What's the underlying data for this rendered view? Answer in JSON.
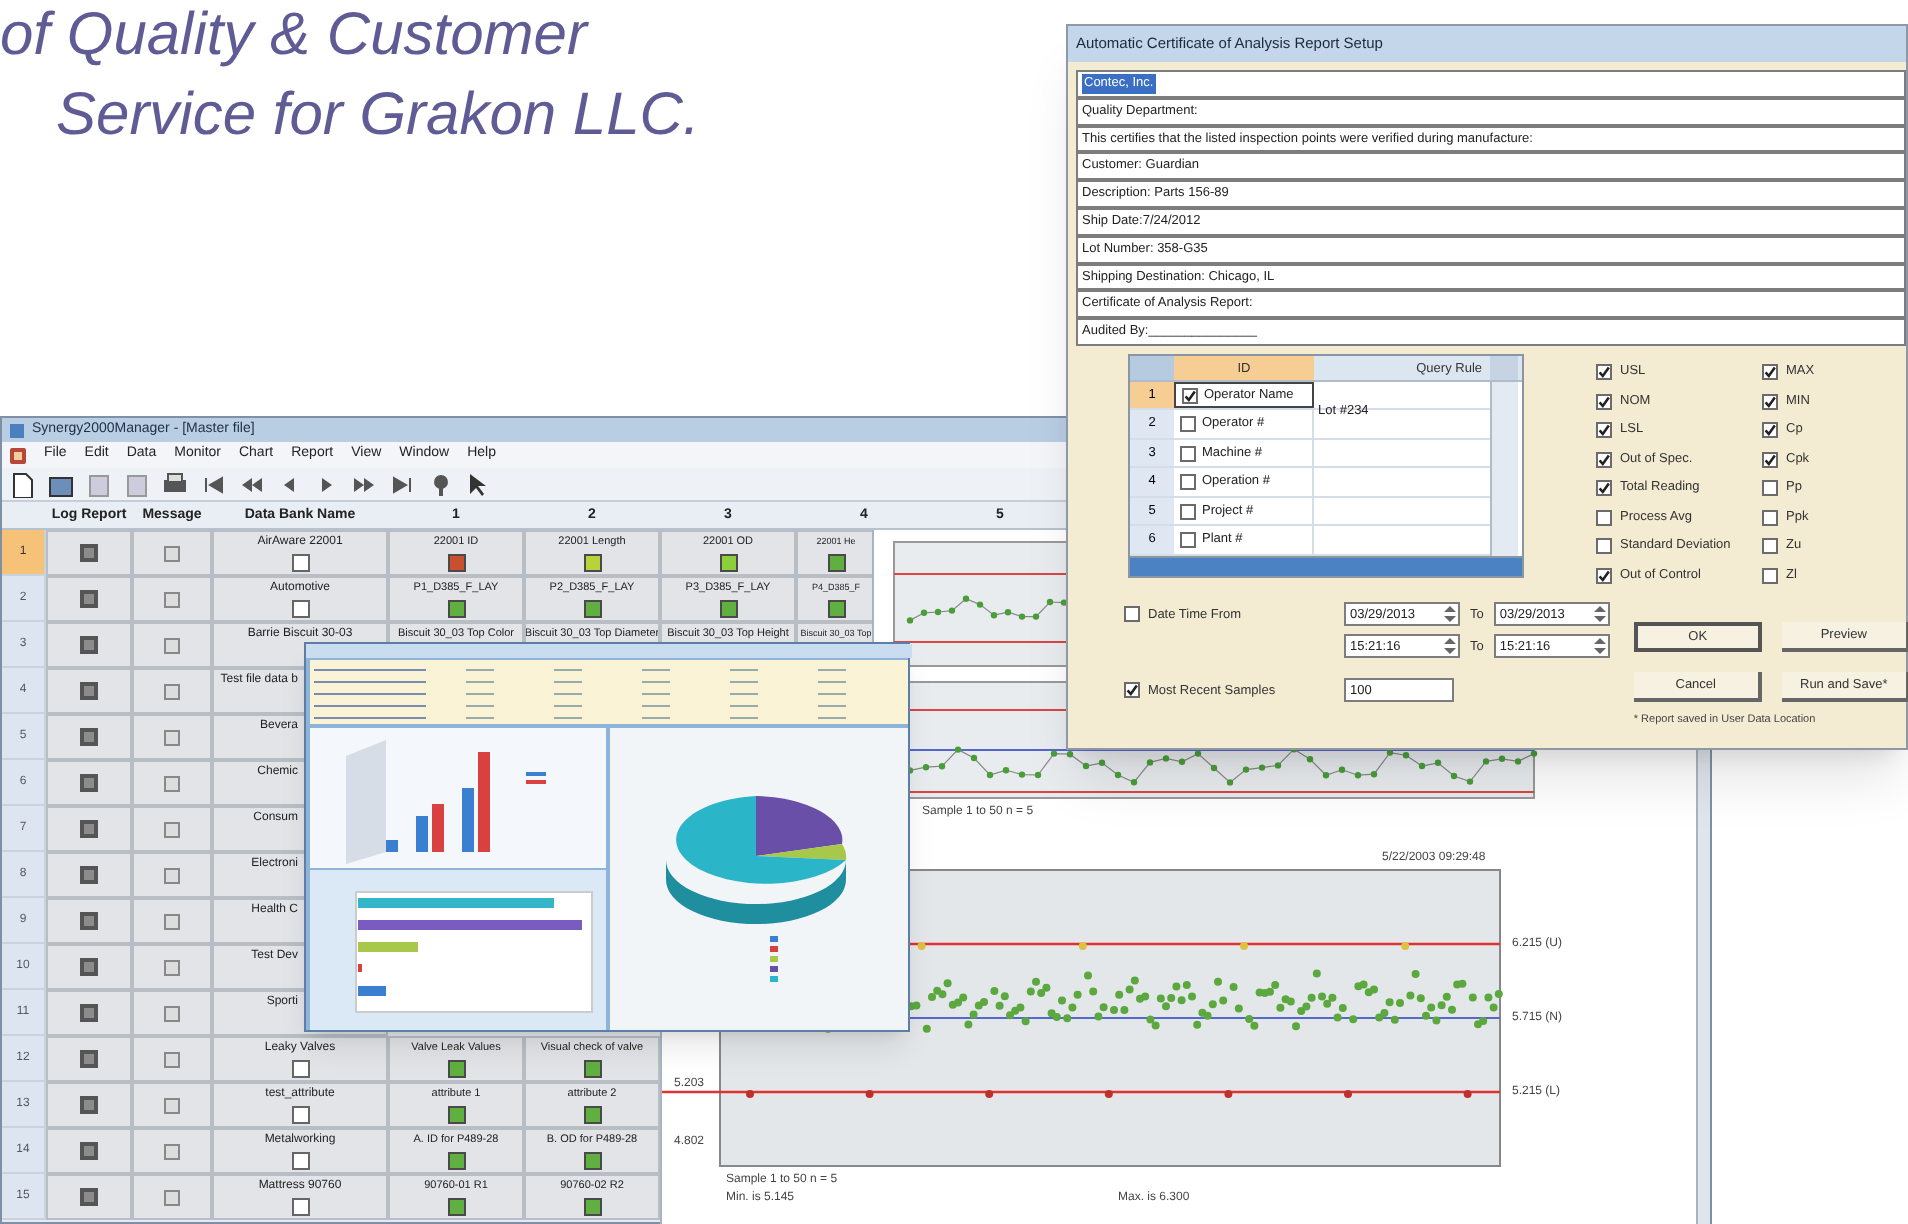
{
  "heading": {
    "lines": [
      "of Quality & Customer",
      "Service for Grakon LLC."
    ]
  },
  "main_window": {
    "title": "Synergy2000Manager - [Master file]",
    "menu": [
      "File",
      "Edit",
      "Data",
      "Monitor",
      "Chart",
      "Report",
      "View",
      "Window",
      "Help"
    ],
    "table": {
      "columns": [
        "Log Report",
        "Message",
        "Data Bank Name",
        "1",
        "2",
        "3",
        "4",
        "5"
      ],
      "rows": [
        {
          "number": "1",
          "selected": true,
          "data_bank": "AirAware 22001",
          "points": [
            {
              "text": "22001 ID",
              "color": "#c8502e"
            },
            {
              "text": "22001 Length",
              "color": "#b7d23a"
            },
            {
              "text": "22001 OD",
              "color": "#8ccf3a"
            },
            {
              "text": "22001 He",
              "color": "#5fb040"
            }
          ]
        },
        {
          "number": "2",
          "selected": false,
          "data_bank": "Automotive",
          "points": [
            {
              "text": "P1_D385_F_LAY",
              "color": "#5fb040"
            },
            {
              "text": "P2_D385_F_LAY",
              "color": "#5fb040"
            },
            {
              "text": "P3_D385_F_LAY",
              "color": "#5fb040"
            },
            {
              "text": "P4_D385_F",
              "color": "#5fb040"
            }
          ]
        },
        {
          "number": "3",
          "selected": false,
          "data_bank": "Barrie Biscuit 30-03",
          "points": [
            {
              "text": "Biscuit 30_03 Top Color"
            },
            {
              "text": "Biscuit 30_03 Top Diameter"
            },
            {
              "text": "Biscuit 30_03 Top Height"
            },
            {
              "text": "Biscuit 30_03 Top"
            }
          ]
        },
        {
          "number": "4",
          "selected": false,
          "data_bank": "Test file data b"
        },
        {
          "number": "5",
          "selected": false,
          "data_bank": "Bevera"
        },
        {
          "number": "6",
          "selected": false,
          "data_bank": "Chemic"
        },
        {
          "number": "7",
          "selected": false,
          "data_bank": "Consum"
        },
        {
          "number": "8",
          "selected": false,
          "data_bank": "Electroni"
        },
        {
          "number": "9",
          "selected": false,
          "data_bank": "Health C"
        },
        {
          "number": "10",
          "selected": false,
          "data_bank": "Test Dev"
        },
        {
          "number": "11",
          "selected": false,
          "data_bank": "Sporti"
        },
        {
          "number": "12",
          "selected": false,
          "data_bank": "Leaky Valves",
          "points": [
            {
              "text": "Valve Leak Values",
              "color": "#5fb040"
            },
            {
              "text": "Visual check of valve",
              "color": "#5fb040"
            }
          ]
        },
        {
          "number": "13",
          "selected": false,
          "data_bank": "test_attribute",
          "points": [
            {
              "text": "attribute 1",
              "color": "#5fb040"
            },
            {
              "text": "attribute 2",
              "color": "#5fb040"
            }
          ]
        },
        {
          "number": "14",
          "selected": false,
          "data_bank": "Metalworking",
          "points": [
            {
              "text": "A. ID for P489-28",
              "color": "#5fb040"
            },
            {
              "text": "B. OD for P489-28",
              "color": "#5fb040"
            }
          ]
        },
        {
          "number": "15",
          "selected": false,
          "data_bank": "Mattress 90760",
          "points": [
            {
              "text": "90760-01 R1",
              "color": "#5fb040"
            },
            {
              "text": "90760-02 R2",
              "color": "#5fb040"
            }
          ]
        }
      ]
    },
    "small_chart": {
      "footer": "Sample 1 to 50  n = 5"
    },
    "control_chart": {
      "timestamp": "5/22/2003 09:29:48",
      "limit_labels": [
        "6.215 (U)",
        "5.715 (N)",
        "5.215 (L)"
      ],
      "axis_labels": [
        "5.203",
        "4.802"
      ],
      "footer": [
        "Sample 1 to 50  n = 5",
        "Min. is 5.145"
      ],
      "max_note": "Max. is 6.300"
    }
  },
  "dialog": {
    "title": "Automatic Certificate of Analysis Report Setup",
    "fields": [
      {
        "value": "Contec, Inc.",
        "selected": true
      },
      {
        "value": "Quality Department:",
        "selected": false
      },
      {
        "value": "This certifies that the listed inspection points were verified during manufacture:",
        "selected": false
      },
      {
        "value": "Customer: Guardian",
        "selected": false
      },
      {
        "value": "Description: Parts 156-89",
        "selected": false
      },
      {
        "value": "Ship Date:7/24/2012",
        "selected": false
      },
      {
        "value": "Lot Number: 358-G35",
        "selected": false
      },
      {
        "value": "Shipping Destination:  Chicago, IL",
        "selected": false
      },
      {
        "value": "Certificate of Analysis Report:",
        "selected": false
      },
      {
        "value": "Audited By:_______________",
        "selected": false
      }
    ],
    "grid": {
      "columns": [
        "ID",
        "Query Rule"
      ],
      "rows": [
        {
          "number": "1",
          "label": "Operator Name",
          "checked": true,
          "rule": "Lot #234",
          "selected": true
        },
        {
          "number": "2",
          "label": "Operator #",
          "checked": false,
          "selected": false
        },
        {
          "number": "3",
          "label": "Machine #",
          "checked": false,
          "selected": false
        },
        {
          "number": "4",
          "label": "Operation #",
          "checked": false,
          "selected": false
        },
        {
          "number": "5",
          "label": "Project #",
          "checked": false,
          "selected": false
        },
        {
          "number": "6",
          "label": "Plant #",
          "checked": false,
          "selected": false
        }
      ]
    },
    "options": [
      [
        {
          "label": "USL",
          "checked": true
        },
        {
          "label": "NOM",
          "checked": true
        },
        {
          "label": "LSL",
          "checked": true
        },
        {
          "label": "Out of Spec.",
          "checked": true
        },
        {
          "label": "Total Reading",
          "checked": true
        },
        {
          "label": "Process Avg",
          "checked": false
        },
        {
          "label": "Standard Deviation",
          "checked": false
        },
        {
          "label": "Out of Control",
          "checked": true
        }
      ],
      [
        {
          "label": "MAX",
          "checked": true
        },
        {
          "label": "MIN",
          "checked": true
        },
        {
          "label": "Cp",
          "checked": true
        },
        {
          "label": "Cpk",
          "checked": true
        },
        {
          "label": "Pp",
          "checked": false
        },
        {
          "label": "Ppk",
          "checked": false
        },
        {
          "label": "Zu",
          "checked": false
        },
        {
          "label": "Zl",
          "checked": false
        }
      ]
    ],
    "date_filter": {
      "label": "Date Time From",
      "checked": false,
      "from_date": "03/29/2013",
      "to_date": "03/29/2013",
      "from_time": "15:21:16",
      "to_time": "15:21:16",
      "to_labels": [
        "To",
        "To"
      ]
    },
    "recent": {
      "label": "Most Recent Samples",
      "checked": true,
      "value": "100"
    },
    "buttons": [
      {
        "label": "OK",
        "default": true
      },
      {
        "label": "Preview",
        "default": false
      },
      {
        "label": "Cancel",
        "default": false
      },
      {
        "label": "Run and Save*",
        "default": false
      }
    ],
    "note": "* Report saved in User Data Location"
  }
}
